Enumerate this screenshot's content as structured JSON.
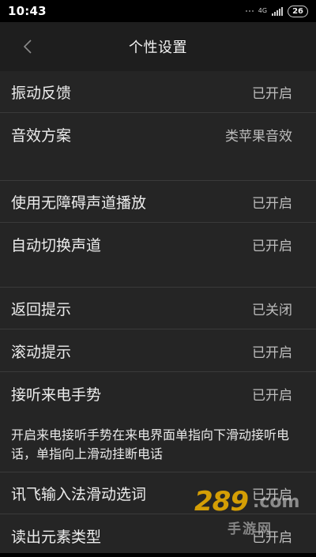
{
  "status_bar": {
    "time": "10:43",
    "network": "4G",
    "battery": "26"
  },
  "header": {
    "title": "个性设置"
  },
  "rows": [
    {
      "label": "振动反馈",
      "value": "已开启"
    },
    {
      "label": "音效方案",
      "value": "类苹果音效"
    },
    {
      "label": "使用无障碍声道播放",
      "value": "已开启"
    },
    {
      "label": "自动切换声道",
      "value": "已开启"
    },
    {
      "label": "返回提示",
      "value": "已关闭"
    },
    {
      "label": "滚动提示",
      "value": "已开启"
    },
    {
      "label": "接听来电手势",
      "value": "已开启"
    },
    {
      "label": "讯飞输入法滑动选词",
      "value": "已开启"
    },
    {
      "label": "读出元素类型",
      "value": "已开启"
    }
  ],
  "description": "开启来电接听手势在来电界面单指向下滑动接听电话，单指向上滑动挂断电话",
  "watermark": {
    "logo": "289",
    "domain": ".com",
    "site_name": "手游网"
  },
  "colors": {
    "background": "#252525",
    "header_background": "#1e1e1e",
    "divider": "#3a3a3a",
    "text": "#ececec",
    "value_text": "#bdbdbd",
    "watermark_accent": "#f3b400"
  },
  "icons": {
    "back": "chevron-left-icon"
  }
}
